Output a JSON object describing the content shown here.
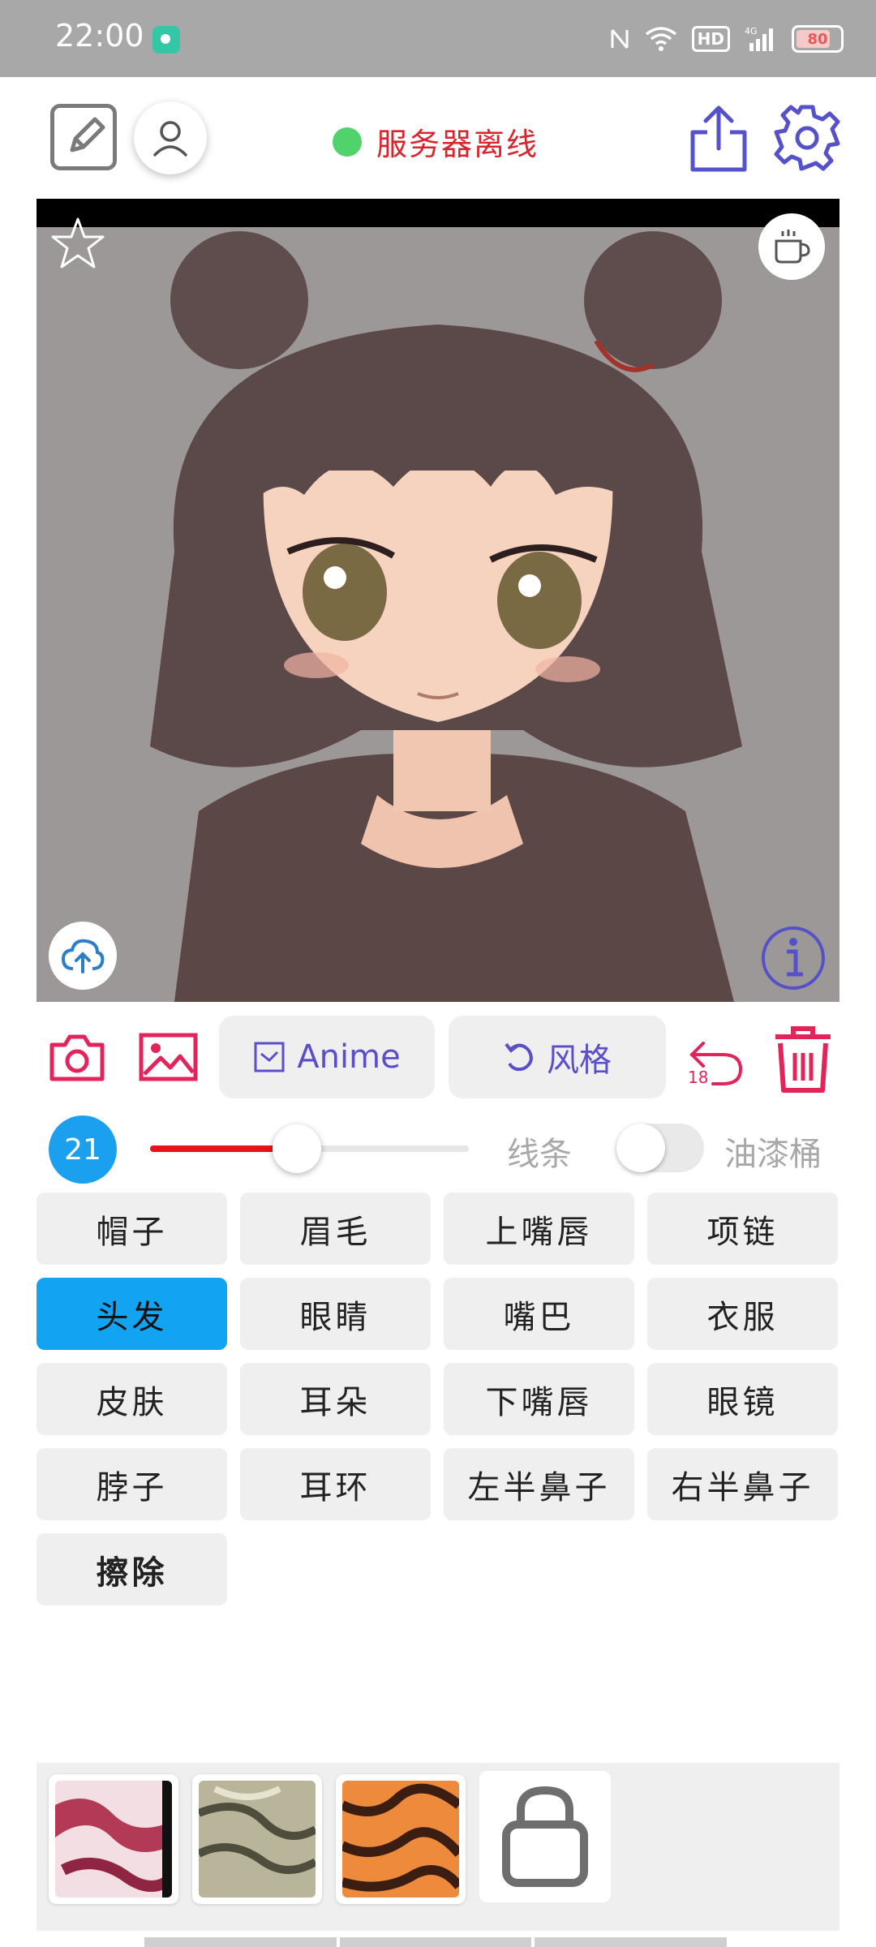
{
  "status_bar": {
    "time": "22:00",
    "battery": "80"
  },
  "header": {
    "server_status": "服务器离线"
  },
  "toolbar": {
    "anime_label": "Anime",
    "style_label": "风格",
    "undo_count": "18"
  },
  "brush": {
    "size": "21",
    "slider_fraction": 0.46
  },
  "modes": {
    "line": "线条",
    "bucket": "油漆桶",
    "bucket_enabled": false
  },
  "parts": [
    "帽子",
    "眉毛",
    "上嘴唇",
    "项链",
    "头发",
    "眼睛",
    "嘴巴",
    "衣服",
    "皮肤",
    "耳朵",
    "下嘴唇",
    "眼镜",
    "脖子",
    "耳环",
    "左半鼻子",
    "右半鼻子",
    "擦除"
  ],
  "selected_part": "头发",
  "colors": {
    "accent_red": "#e2245a",
    "accent_purple": "#5a4fc8",
    "selected_blue": "#12a3f2",
    "status_green": "#4fd36a"
  }
}
